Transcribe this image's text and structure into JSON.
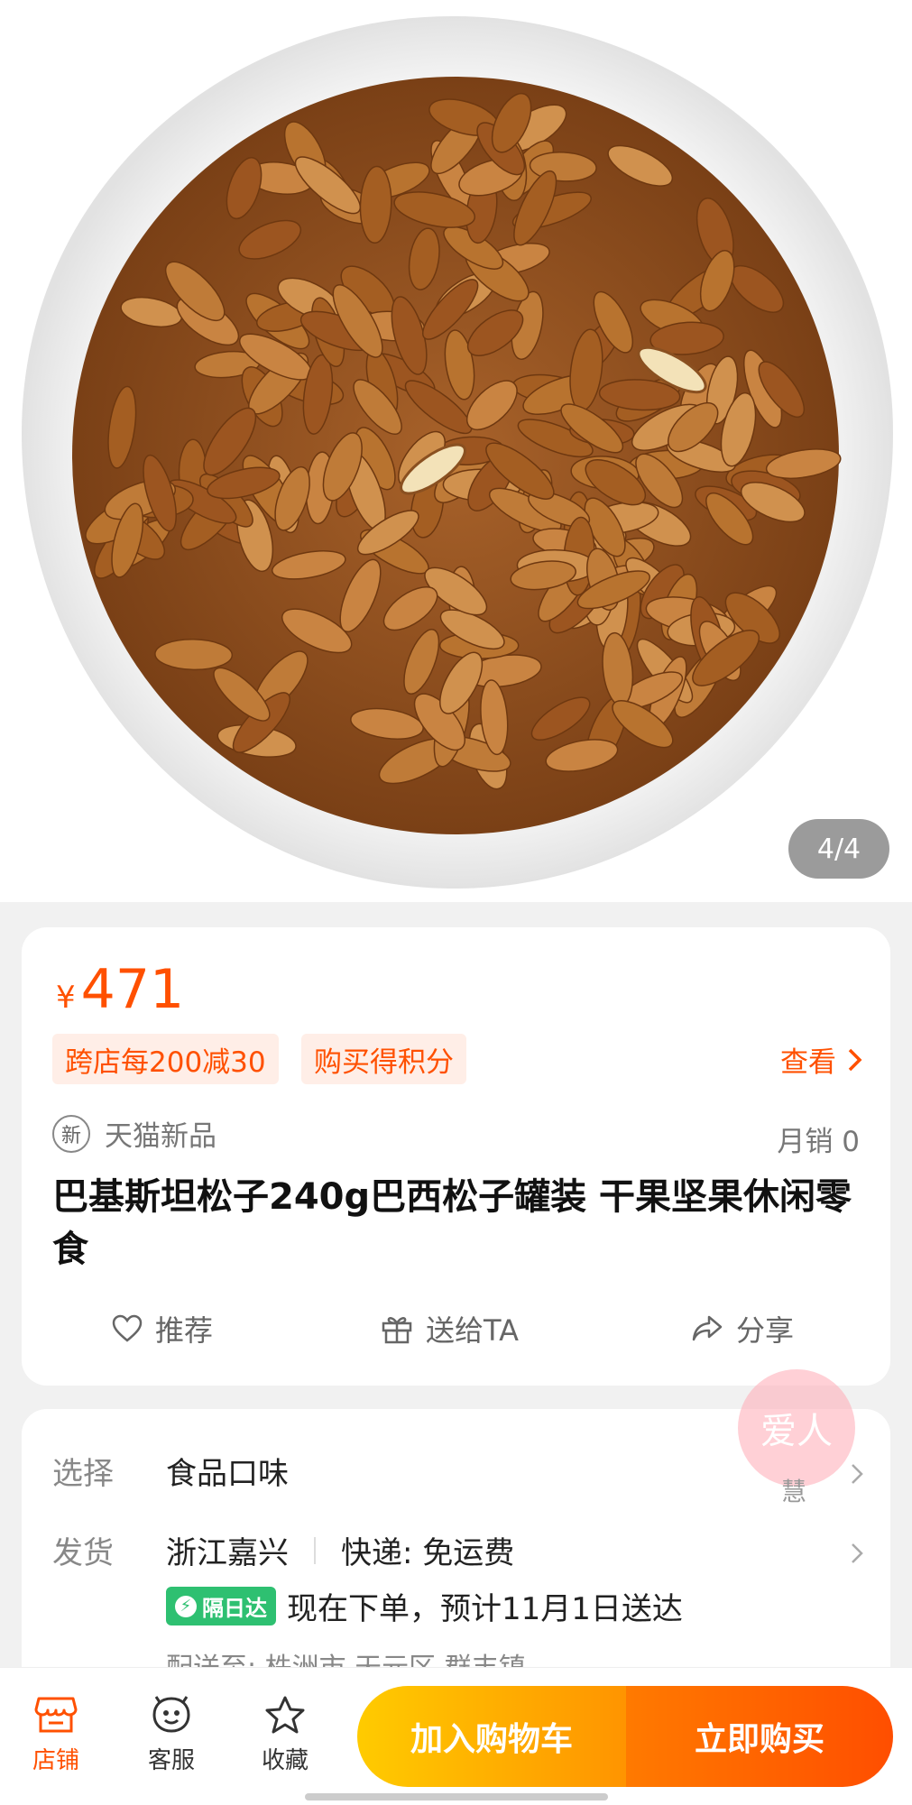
{
  "gallery": {
    "counter": "4/4"
  },
  "price": {
    "currency": "¥",
    "amount": "471"
  },
  "promos": {
    "tag1": "跨店每200减30",
    "tag2": "购买得积分",
    "view_label": "查看"
  },
  "badge": {
    "icon_text": "新",
    "label": "天猫新品"
  },
  "sales": "月销 0",
  "product_title": "巴基斯坦松子240g巴西松子罐装 干果坚果休闲零食",
  "actions": {
    "recommend": "推荐",
    "gift": "送给TA",
    "share": "分享"
  },
  "options": {
    "select_key": "选择",
    "select_value": "食品口味",
    "ship_key": "发货",
    "ship_origin": "浙江嘉兴",
    "ship_express": "快递: 免运费",
    "next_day_badge": "隔日达",
    "delivery_text": "现在下单，预计11月1日送达",
    "deliver_to": "配送至: 株洲市 天元区 群丰镇"
  },
  "watermark": {
    "main": "爱人",
    "sub": "慧"
  },
  "bottom_bar": {
    "shop": "店铺",
    "service": "客服",
    "favorite": "收藏",
    "add_to_cart": "加入购物车",
    "buy_now": "立即购买"
  },
  "colors": {
    "accent": "#ff5000",
    "cart_start": "#ffcb00",
    "buy_end": "#ff4e00",
    "green": "#2ec071"
  }
}
